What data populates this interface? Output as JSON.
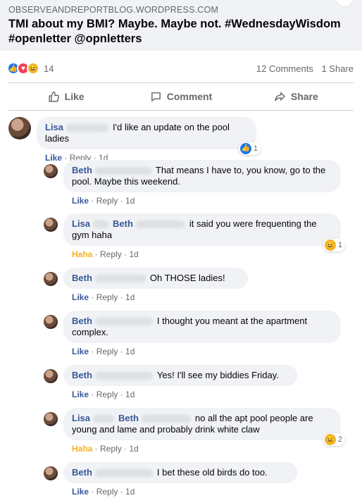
{
  "post": {
    "domain": "OBSERVEANDREPORTBLOG.WORDPRESS.COM",
    "title": "TMI about my BMI? Maybe. Maybe not. #WednesdayWisdom #openletter @opnletters"
  },
  "stats": {
    "reaction_count": "14",
    "comments": "12 Comments",
    "shares": "1 Share"
  },
  "actions": {
    "like": "Like",
    "comment": "Comment",
    "share": "Share"
  },
  "comments": [
    {
      "author": "Lisa",
      "text": "I'd like an update on the pool ladies",
      "like": "Like",
      "reply": "Reply",
      "time": "1d",
      "reaction_count": "1"
    },
    {
      "author": "Beth",
      "text": "That means I have to, you know, go to the pool. Maybe this weekend.",
      "like": "Like",
      "reply": "Reply",
      "time": "1d"
    },
    {
      "author": "Lisa",
      "tag": "Beth",
      "text": "it said you were frequenting the gym haha",
      "like": "Haha",
      "reply": "Reply",
      "time": "1d",
      "reaction_count": "1"
    },
    {
      "author": "Beth",
      "text": "Oh THOSE ladies!",
      "like": "Like",
      "reply": "Reply",
      "time": "1d"
    },
    {
      "author": "Beth",
      "text": "I thought you meant at the apartment complex.",
      "like": "Like",
      "reply": "Reply",
      "time": "1d"
    },
    {
      "author": "Beth",
      "text": "Yes! I'll see my biddies Friday.",
      "like": "Like",
      "reply": "Reply",
      "time": "1d"
    },
    {
      "author": "Lisa",
      "tag": "Beth",
      "text": "no all the apt pool people are young and lame and probably drink white claw",
      "like": "Haha",
      "reply": "Reply",
      "time": "1d",
      "reaction_count": "2"
    },
    {
      "author": "Beth",
      "text": "I bet these old birds do too.",
      "like": "Like",
      "reply": "Reply",
      "time": "1d"
    }
  ],
  "colors": {
    "link": "#385898",
    "haha": "#f7b125",
    "like": "#1877f2",
    "love": "#f33e58"
  },
  "icons": [
    "thumbs-up-icon",
    "comment-icon",
    "share-icon",
    "like-reaction-icon",
    "love-reaction-icon",
    "haha-reaction-icon"
  ]
}
